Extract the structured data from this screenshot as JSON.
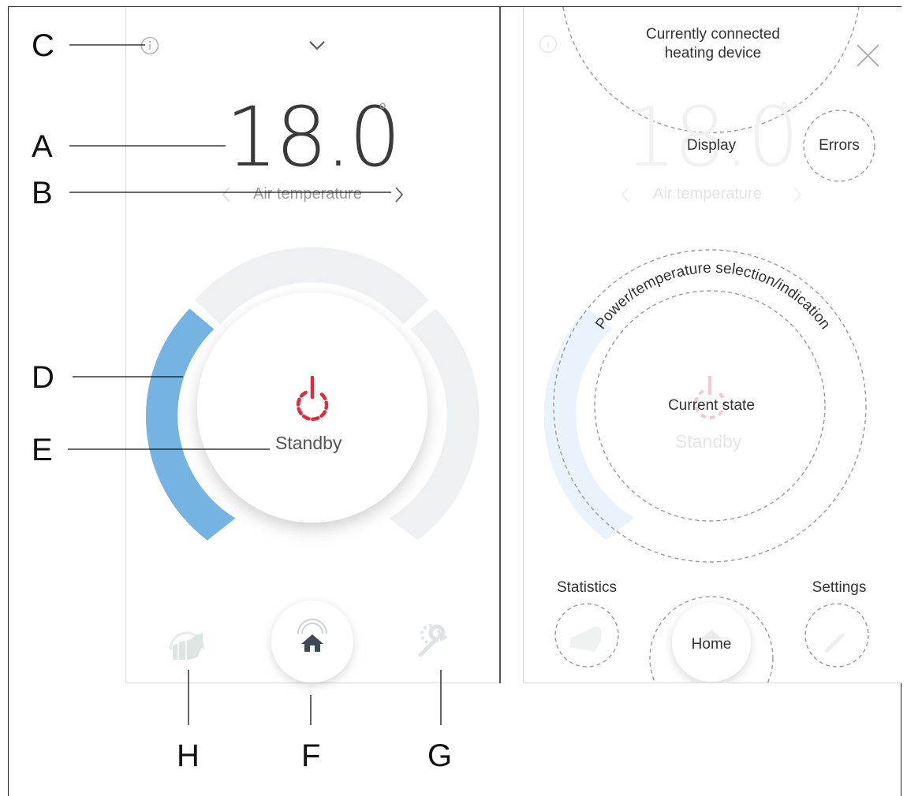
{
  "left": {
    "temperature": "18.0",
    "degree_symbol": "°",
    "temp_label": "Air temperature",
    "state_label": "Standby",
    "colors": {
      "accent": "#74b3e2",
      "power": "#e8283c",
      "track": "#eef0f2",
      "home_icon": "#3d4a55"
    }
  },
  "right": {
    "temperature": "18.0",
    "degree_symbol": "°",
    "temp_label": "Air temperature",
    "state_label": "Standby",
    "callouts": {
      "connected_line1": "Currently connected",
      "connected_line2": "heating device",
      "display": "Display",
      "errors": "Errors",
      "ring": "Power/temperature selection/indication",
      "current_state": "Current state",
      "statistics": "Statistics",
      "settings": "Settings",
      "home": "Home"
    }
  },
  "annotations": {
    "a": "A",
    "b": "B",
    "c": "C",
    "d": "D",
    "e": "E",
    "f": "F",
    "g": "G",
    "h": "H"
  }
}
